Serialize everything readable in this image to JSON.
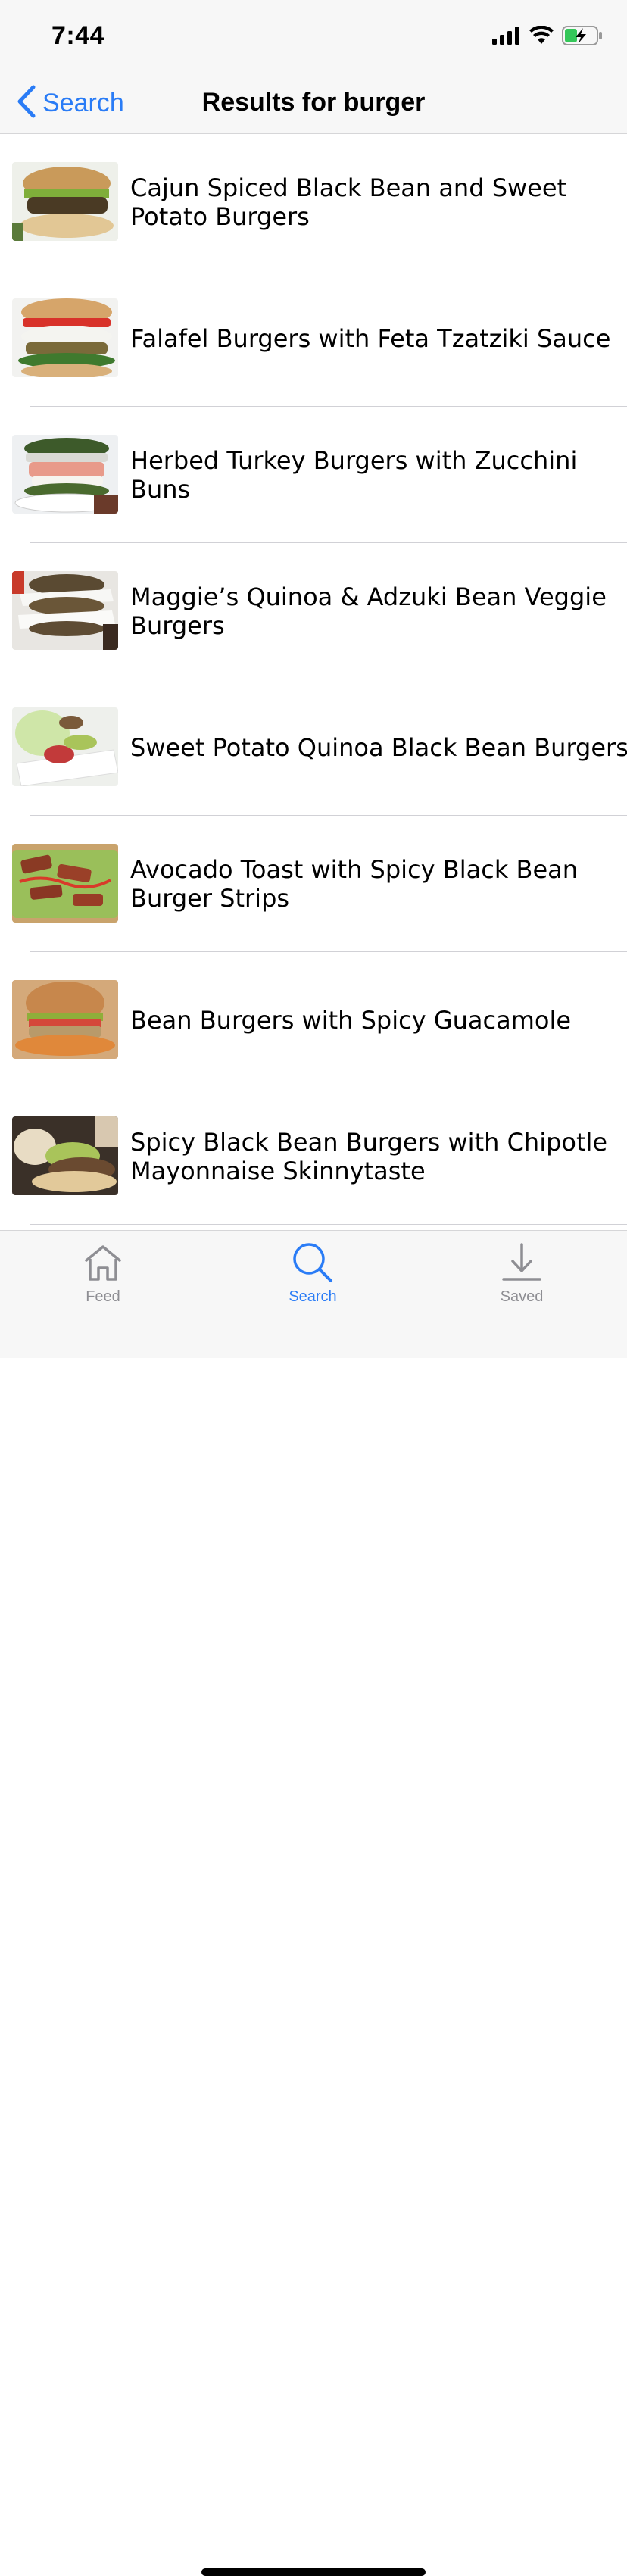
{
  "status_bar": {
    "time": "7:44"
  },
  "nav": {
    "back_label": "Search",
    "title": "Results for burger"
  },
  "results": [
    {
      "title": "Cajun Spiced Black Bean and Sweet Potato Burgers"
    },
    {
      "title": "Falafel Burgers with Feta Tzatziki Sauce"
    },
    {
      "title": "Herbed Turkey Burgers with Zucchini Buns"
    },
    {
      "title": "Maggie’s Quinoa & Adzuki Bean Veggie Burgers"
    },
    {
      "title": "Sweet Potato Quinoa Black Bean Burgers"
    },
    {
      "title": "Avocado Toast with Spicy Black Bean Burger Strips"
    },
    {
      "title": "Bean Burgers with Spicy Guacamole"
    },
    {
      "title": "Spicy Black Bean Burgers with Chipotle Mayonnaise Skinnytaste"
    }
  ],
  "tabs": [
    {
      "label": "Feed",
      "icon": "home-icon",
      "selected": false
    },
    {
      "label": "Search",
      "icon": "search-icon",
      "selected": true
    },
    {
      "label": "Saved",
      "icon": "download-icon",
      "selected": false
    }
  ],
  "colors": {
    "accent": "#2a7cf6",
    "inactive_tab": "#8e8e93",
    "separator": "#d1d1d6",
    "bar_background": "#f7f7f7"
  }
}
